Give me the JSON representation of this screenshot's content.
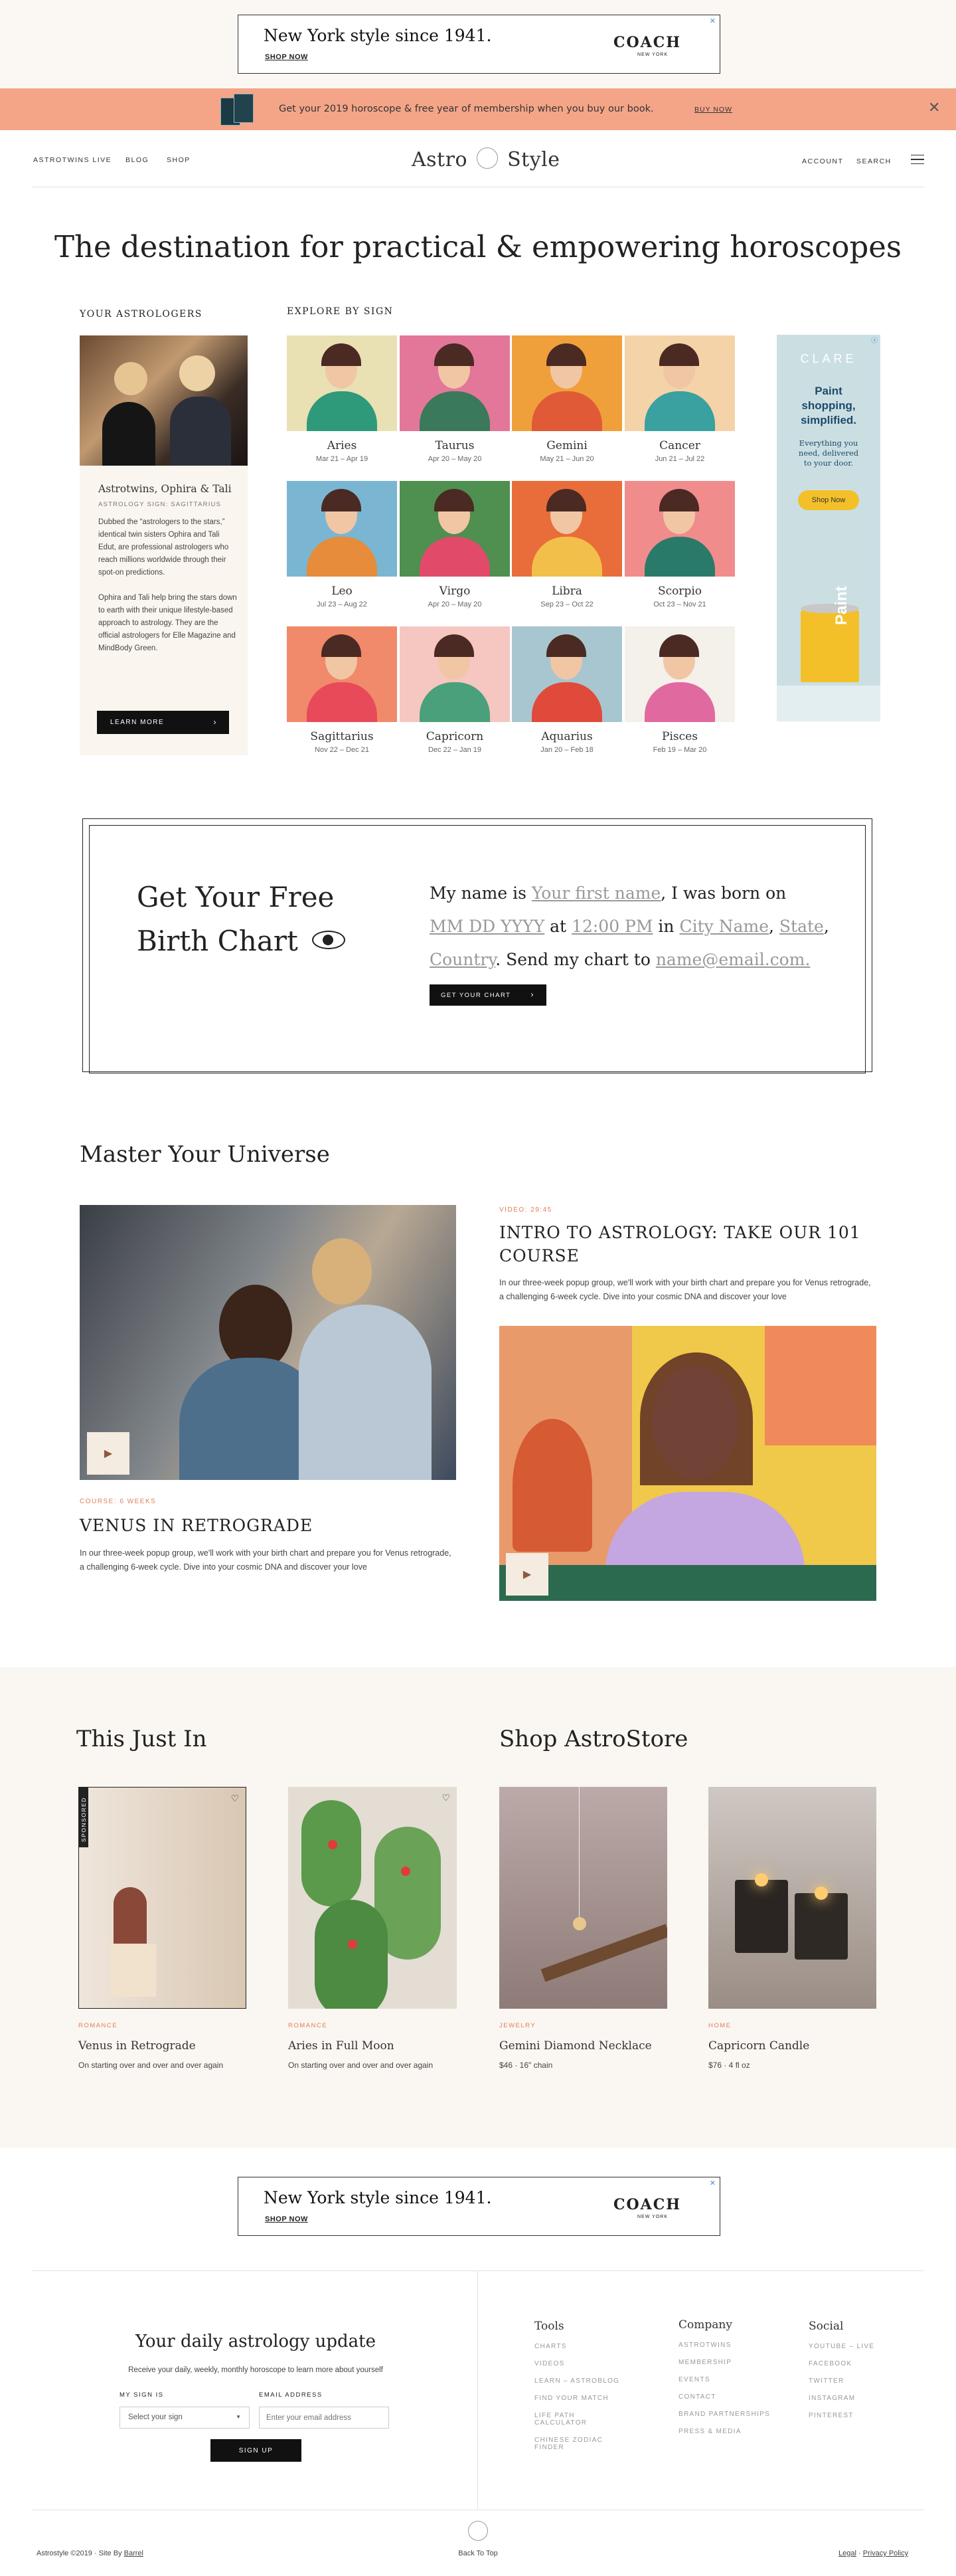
{
  "ad": {
    "title": "New York style since 1941.",
    "shop": "SHOP NOW",
    "logo": "COACH",
    "logo_sub": "NEW YORK",
    "close": "✕"
  },
  "promo": {
    "text": "Get your 2019 horoscope & free year of membership when you buy our book.",
    "link": "BUY NOW",
    "close": "✕"
  },
  "nav": {
    "left": [
      "ASTROTWINS LIVE",
      "BLOG",
      "SHOP"
    ],
    "logo_left": "Astro",
    "logo_right": "Style",
    "account": "ACCOUNT",
    "search": "SEARCH"
  },
  "hero": {
    "title": "The destination for practical & empowering horoscopes"
  },
  "astrologers": {
    "label": "YOUR ASTROLOGERS",
    "name": "Astrotwins, Ophira & Tali",
    "sub": "ASTROLOGY SIGN: SAGITTARIUS",
    "bio1": "Dubbed the “astrologers to the stars,” identical twin sisters Ophira and Tali Edut, are professional astrologers who reach millions worldwide through their spot-on predictions.",
    "bio2": "Ophira and Tali help bring the stars down to earth with their unique lifestyle-based approach to astrology. They are the official astrologers for Elle Magazine and MindBody Green.",
    "button": "LEARN MORE"
  },
  "signs": {
    "label": "EXPLORE BY SIGN",
    "items": [
      {
        "name": "Aries",
        "date": "Mar 21 – Apr 19",
        "bg": "#e9e0b4",
        "accent": "#2f9a7a"
      },
      {
        "name": "Taurus",
        "date": "Apr 20 – May 20",
        "bg": "#e2779a",
        "accent": "#3a7a5a"
      },
      {
        "name": "Gemini",
        "date": "May 21 – Jun 20",
        "bg": "#f0a03a",
        "accent": "#e05a38"
      },
      {
        "name": "Cancer",
        "date": "Jun 21 – Jul 22",
        "bg": "#f4d3a8",
        "accent": "#3aa0a0"
      },
      {
        "name": "Leo",
        "date": "Jul 23 – Aug 22",
        "bg": "#7ab6d2",
        "accent": "#e68c3a"
      },
      {
        "name": "Virgo",
        "date": "Apr 20 – May 20",
        "bg": "#4f8f4f",
        "accent": "#e24a6a"
      },
      {
        "name": "Libra",
        "date": "Sep 23 – Oct 22",
        "bg": "#e86d3a",
        "accent": "#f2c04a"
      },
      {
        "name": "Scorpio",
        "date": "Oct 23 – Nov 21",
        "bg": "#f08c8c",
        "accent": "#2a7a6a"
      },
      {
        "name": "Sagittarius",
        "date": "Nov 22 – Dec 21",
        "bg": "#f08a6a",
        "accent": "#e84a5a"
      },
      {
        "name": "Capricorn",
        "date": "Dec 22 – Jan 19",
        "bg": "#f6c6c0",
        "accent": "#4aa07a"
      },
      {
        "name": "Aquarius",
        "date": "Jan 20 – Feb 18",
        "bg": "#a8c6d0",
        "accent": "#e04a3a"
      },
      {
        "name": "Pisces",
        "date": "Feb 19 – Mar 20",
        "bg": "#f4f0ea",
        "accent": "#e06aa0"
      }
    ]
  },
  "side_ad": {
    "brand": "CLARE",
    "title": "Paint shopping, simplified.",
    "body": "Everything you need, delivered to your door.",
    "button": "Shop Now",
    "can_label": "Paint",
    "x": "ⓧ"
  },
  "chart": {
    "title_line1": "Get Your Free",
    "title_line2": "Birth Chart",
    "t1": "My name is ",
    "f_name": "Your first name",
    "t2": ", I was born on",
    "f_date": "MM DD YYYY",
    "t3": " at ",
    "f_time": "12:00 PM",
    "t4": " in ",
    "f_city": "City Name",
    "t5": ", ",
    "f_state": "State",
    "t6": ",",
    "f_country": "Country",
    "t7": ". Send my chart to ",
    "f_email": "name@email.com.",
    "button": "GET YOUR CHART"
  },
  "master": {
    "title": "Master Your Universe",
    "left_label": "COURSE: 6 WEEKS",
    "left_title": "VENUS IN RETROGRADE",
    "left_desc": "In our three-week popup group, we'll work with your birth chart and prepare you for Venus retrograde, a challenging 6-week cycle. Dive into your cosmic DNA and discover your love",
    "right_label": "VIDEO: 29:45",
    "right_title": "INTRO TO ASTROLOGY: TAKE OUR 101 COURSE",
    "right_desc": "In our three-week popup group, we'll work with your birth chart and prepare you for Venus retrograde, a challenging 6-week cycle. Dive into your cosmic DNA and discover your love",
    "play": "▶"
  },
  "just_in": {
    "title": "This Just In",
    "sponsored": "SPONSORED",
    "items": [
      {
        "cat": "ROMANCE",
        "title": "Venus in Retrograde",
        "desc": "On starting over and over and over again"
      },
      {
        "cat": "ROMANCE",
        "title": "Aries in Full Moon",
        "desc": "On starting over and over and over again"
      }
    ]
  },
  "store": {
    "title": "Shop AstroStore",
    "items": [
      {
        "cat": "JEWELRY",
        "title": "Gemini Diamond Necklace",
        "desc": "$46 · 16\" chain"
      },
      {
        "cat": "HOME",
        "title": "Capricorn Candle",
        "desc": "$76 · 4 fl oz"
      }
    ]
  },
  "newsletter": {
    "title": "Your daily astrology update",
    "sub": "Receive your daily, weekly, monthly horoscope to learn more about yourself",
    "sign_label": "MY SIGN IS",
    "sign_value": "Select your sign",
    "email_label": "EMAIL ADDRESS",
    "email_placeholder": "Enter your email address",
    "button": "SIGN UP"
  },
  "footer": {
    "tools": {
      "title": "Tools",
      "links": [
        "CHARTS",
        "VIDEOS",
        "LEARN – ASTROBLOG",
        "FIND YOUR MATCH",
        "LIFE PATH CALCULATOR",
        "CHINESE ZODIAC FINDER"
      ]
    },
    "company": {
      "title": "Company",
      "links": [
        "ASTROTWINS",
        "MEMBERSHIP",
        "EVENTS",
        "CONTACT",
        "BRAND PARTNERSHIPS",
        "PRESS & MEDIA"
      ]
    },
    "social": {
      "title": "Social",
      "links": [
        "YOUTUBE – LIVE",
        "FACEBOOK",
        "TWITTER",
        "INSTAGRAM",
        "PINTEREST"
      ]
    },
    "copyright": "Astrostyle ©2019 · Site By ",
    "site_by": "Barrel",
    "back_to_top": "Back To Top",
    "legal": "Legal",
    "sep": " · ",
    "privacy": "Privacy Policy"
  }
}
